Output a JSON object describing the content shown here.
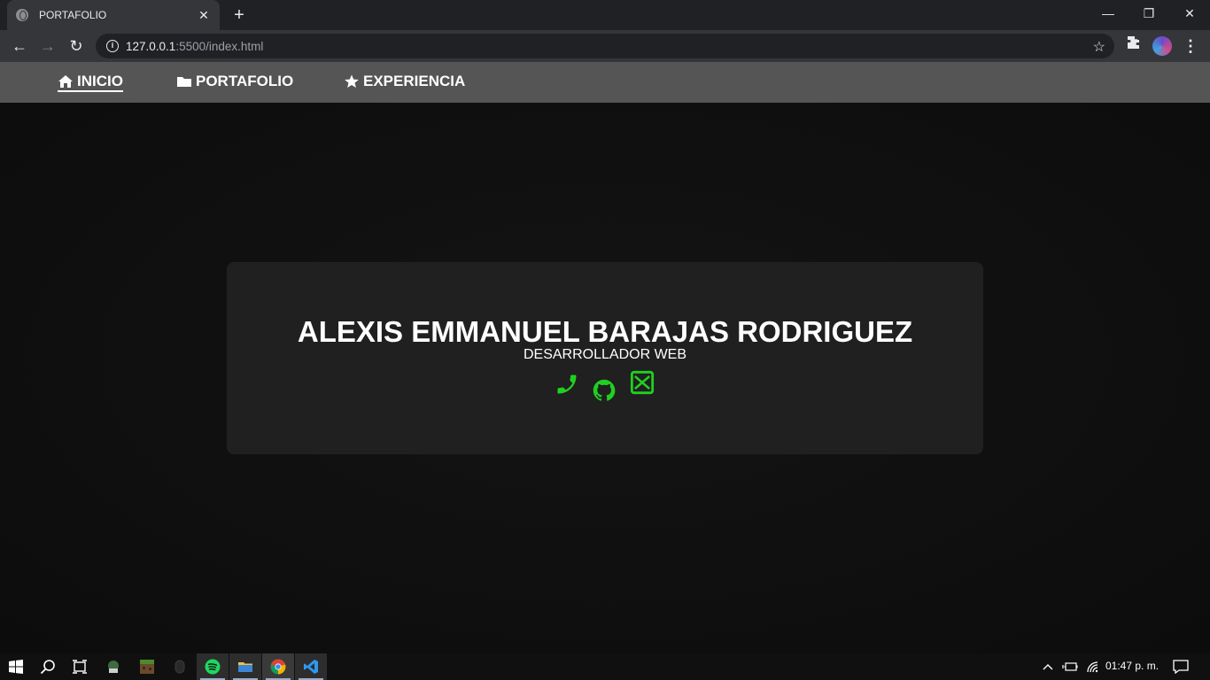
{
  "browser": {
    "tab_title": "PORTAFOLIO",
    "tab_close": "✕",
    "new_tab": "+",
    "url_host": "127.0.0.1",
    "url_rest": ":5500/index.html"
  },
  "site": {
    "nav": [
      {
        "label": "INICIO",
        "icon": "home-icon"
      },
      {
        "label": "PORTAFOLIO",
        "icon": "folder-icon"
      },
      {
        "label": "EXPERIENCIA",
        "icon": "star-icon"
      }
    ],
    "hero": {
      "name": "ALEXIS EMMANUEL BARAJAS RODRIGUEZ",
      "role": "DESARROLLADOR WEB",
      "contacts": [
        "phone-icon",
        "github-icon",
        "mail-icon"
      ]
    },
    "accent_color": "#1fd11f",
    "nav_bg": "#555555",
    "card_bg": "#202020"
  },
  "taskbar": {
    "items": [
      "windows-start-icon",
      "search-icon",
      "task-view-icon",
      "app-icon",
      "minecraft-icon",
      "mouse-icon",
      "spotify-icon",
      "file-explorer-icon",
      "chrome-icon",
      "vscode-icon"
    ],
    "clock": "01:47 p. m."
  }
}
